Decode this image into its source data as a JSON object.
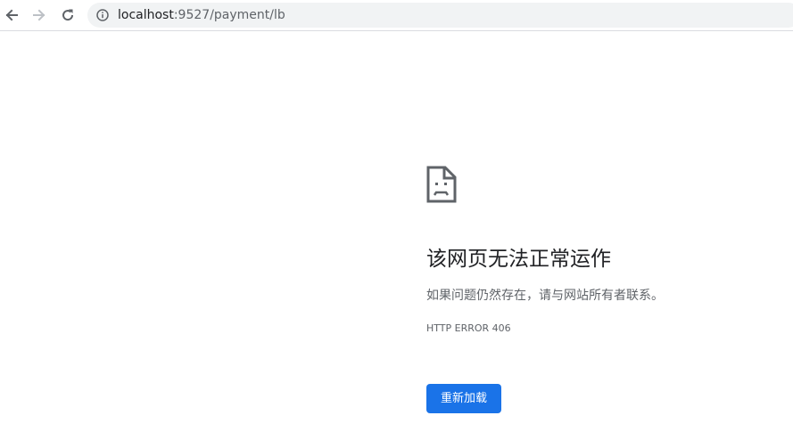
{
  "toolbar": {
    "back_icon": "arrow-left-icon",
    "forward_icon": "arrow-right-icon",
    "reload_icon": "reload-icon",
    "info_icon": "info-circle-icon",
    "url_host": "localhost",
    "url_rest": ":9527/payment/lb"
  },
  "error": {
    "icon": "sad-page-icon",
    "title": "该网页无法正常运作",
    "description": "如果问题仍然存在，请与网站所有者联系。",
    "code": "HTTP ERROR 406",
    "reload_label": "重新加载"
  },
  "colors": {
    "button_blue": "#1a73e8",
    "title_text": "#202124",
    "secondary_text": "#5f6368",
    "omnibox_bg": "#f1f3f4"
  }
}
